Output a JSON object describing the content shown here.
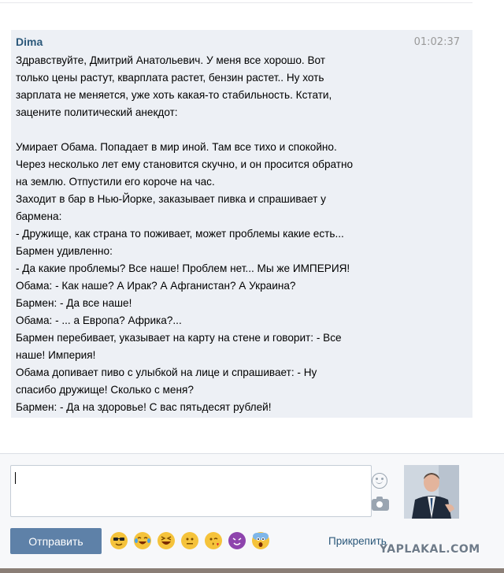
{
  "message": {
    "author": "Dima",
    "time": "01:02:37",
    "text": "Здравствуйте, Дмитрий Анатольевич. У меня все хорошо. Вот\nтолько цены растут, кварплата растет, бензин растет.. Ну хоть\nзарплата не меняется, уже хоть какая-то стабильность. Кстати,\nзацените политический анекдот:\n\nУмирает Обама. Попадает в мир иной. Там все тихо и спокойно.\nЧерез несколько лет ему становится скучно, и он просится обратно\nна землю. Отпустили его короче на час.\nЗаходит в бар в Нью-Йорке, заказывает пивка и спрашивает у\nбармена:\n- Дружище, как страна то поживает, может проблемы какие есть...\nБармен удивленно:\n- Да какие проблемы? Все наше! Проблем нет... Мы же ИМПЕРИЯ!\nОбама: - Как наше? А Ирак? А Афганистан? А Украина?\nБармен: - Да все наше!\nОбама: - ... а Европа? Африка?...\nБармен перебивает, указывает на карту на стене и говорит: - Все\nнаше! Империя!\nОбама допивает пиво с улыбкой на лице и спрашивает: - Ну\nспасибо дружище! Сколько с меня?\nБармен: - Да на здоровье! С вас пятьдесят рублей!"
  },
  "composer": {
    "input_value": "",
    "send_label": "Отправить",
    "attach_label": "Прикрепить",
    "emojis": [
      {
        "name": "sunglasses-emoji-icon",
        "color": "#f5c33b"
      },
      {
        "name": "tears-of-joy-emoji-icon",
        "color": "#f5c33b"
      },
      {
        "name": "laughing-emoji-icon",
        "color": "#f5c33b"
      },
      {
        "name": "neutral-face-emoji-icon",
        "color": "#f5c33b"
      },
      {
        "name": "wink-kiss-emoji-icon",
        "color": "#f5c33b"
      },
      {
        "name": "devil-emoji-icon",
        "color": "#8e44ad"
      },
      {
        "name": "scream-emoji-icon",
        "color": "#f5c33b"
      }
    ]
  },
  "watermark": "YAPLAKAL.COM",
  "colors": {
    "message_bg": "#edf0f5",
    "author": "#2b587a",
    "send_button": "#5e81a8"
  }
}
